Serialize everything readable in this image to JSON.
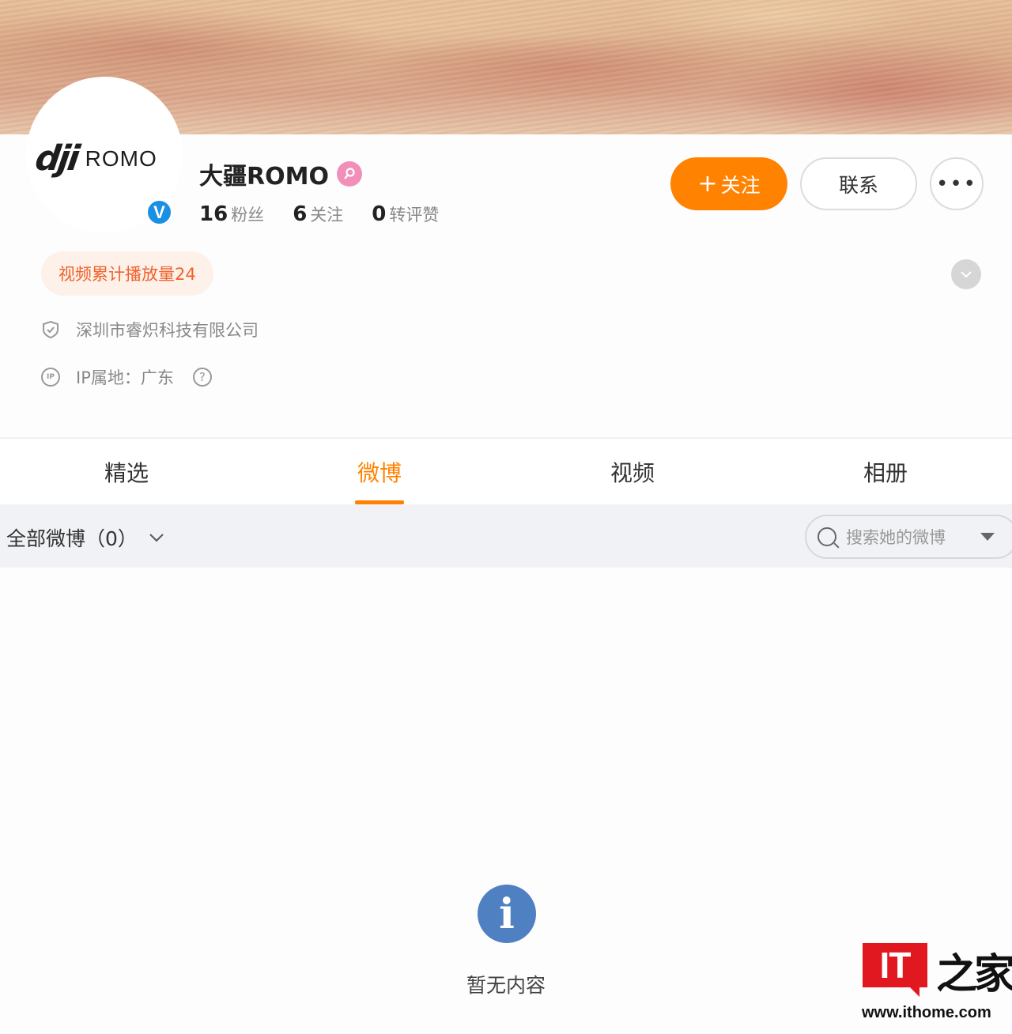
{
  "cover": {
    "description_icon": "sand-banner"
  },
  "profile": {
    "logo_main": "dji",
    "logo_sub": "ROMO",
    "verified_mark": "V",
    "name": "大疆ROMO",
    "gender_icon": "female-icon",
    "stats": [
      {
        "value": "16",
        "label": "粉丝"
      },
      {
        "value": "6",
        "label": "关注"
      },
      {
        "value": "0",
        "label": "转评赞"
      }
    ]
  },
  "actions": {
    "follow_plus": "+",
    "follow_label": "关注",
    "contact_label": "联系",
    "more_label": "•••"
  },
  "tag": {
    "label": "视频累计播放量24"
  },
  "info": {
    "company": "深圳市睿炽科技有限公司",
    "ip_icon_text": "IP",
    "ip_location": "IP属地：广东",
    "help_mark": "?"
  },
  "tabs": [
    {
      "label": "精选",
      "active": false
    },
    {
      "label": "微博",
      "active": true
    },
    {
      "label": "视频",
      "active": false
    },
    {
      "label": "相册",
      "active": false
    }
  ],
  "filter": {
    "label": "全部微博（0）",
    "search_placeholder": "搜索她的微博"
  },
  "empty": {
    "icon_text": "i",
    "message": "暂无内容"
  },
  "watermark": {
    "logo_it": "IT",
    "logo_cn": "之家",
    "url": "www.ithome.com"
  },
  "colors": {
    "accent": "#ff8200",
    "tag_text": "#f0622a",
    "verified": "#1a8fe3",
    "info_icon": "#4f80c2"
  }
}
